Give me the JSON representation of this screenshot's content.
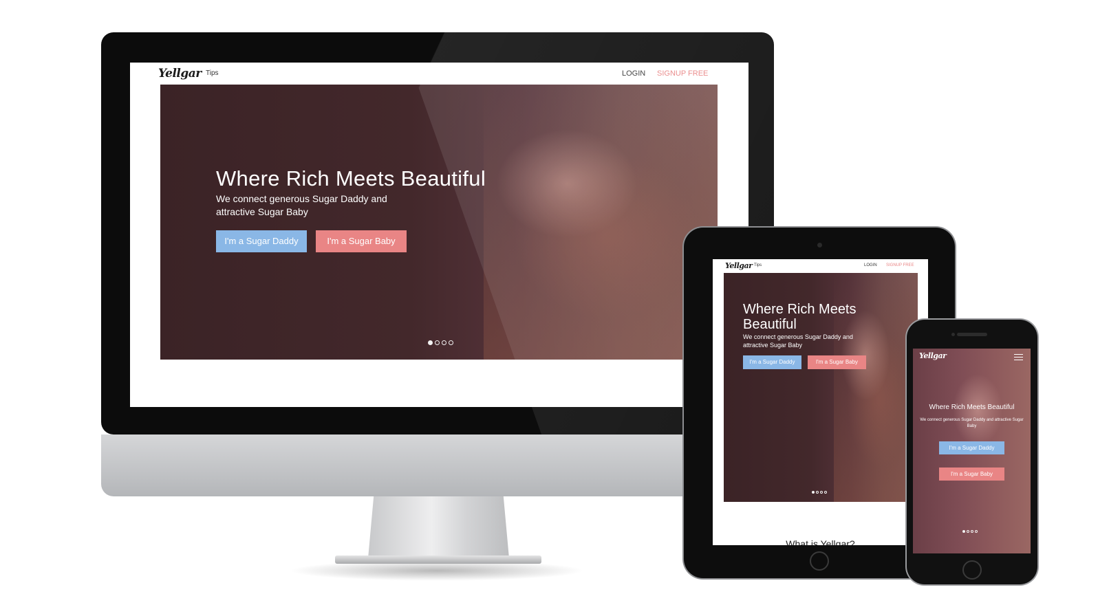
{
  "site": {
    "logo": "Yellgar",
    "nav_tips": "Tips",
    "nav_login": "LOGIN",
    "nav_signup": "SIGNUP FREE",
    "hero_title": "Where Rich Meets Beautiful",
    "hero_title_line1": "Where Rich Meets",
    "hero_title_line2": "Beautiful",
    "hero_subtitle": "We connect generous Sugar Daddy and attractive Sugar Baby",
    "hero_subtitle_line1": "We connect generous Sugar Daddy and",
    "hero_subtitle_line2": "attractive Sugar Baby",
    "btn_daddy": "I'm a Sugar Daddy",
    "btn_baby": "I'm a Sugar Baby",
    "section_heading": "What is Yellgar?",
    "carousel": {
      "slides": 4,
      "active": 1
    }
  },
  "colors": {
    "signup_accent": "#e98585",
    "btn_daddy": "#8ab7e6",
    "btn_baby": "#e98585",
    "hero_overlay": "#3b2326"
  },
  "icons": {
    "menu": "hamburger-menu-icon"
  }
}
